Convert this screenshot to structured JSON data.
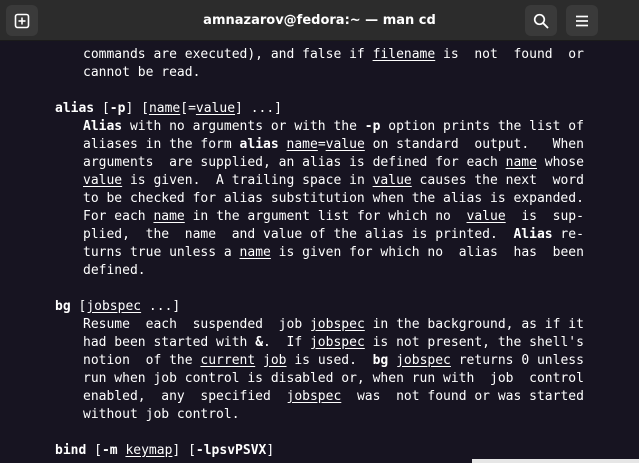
{
  "window": {
    "title": "amnazarov@fedora:~ — man cd",
    "icons": {
      "new_tab": "new-tab-icon",
      "search": "search-icon",
      "menu": "hamburger-menu-icon"
    }
  },
  "colors": {
    "headerbar": "#2c2c2c",
    "button": "#3a3a3a",
    "terminal_bg": "#171421",
    "text": "#ffffff"
  },
  "terminal": {
    "lines": [
      {
        "indent": 8,
        "segs": [
          {
            "t": "commands are executed), and false if "
          },
          {
            "t": "filename",
            "u": true
          },
          {
            "t": " is  not  found  or"
          }
        ]
      },
      {
        "indent": 8,
        "segs": [
          {
            "t": "cannot be read."
          }
        ]
      },
      {
        "indent": 0,
        "segs": []
      },
      {
        "indent": 4,
        "segs": [
          {
            "t": "alias",
            "b": true
          },
          {
            "t": " ["
          },
          {
            "t": "-p",
            "b": true
          },
          {
            "t": "] ["
          },
          {
            "t": "name",
            "u": true
          },
          {
            "t": "[="
          },
          {
            "t": "value",
            "u": true
          },
          {
            "t": "] ...]"
          }
        ]
      },
      {
        "indent": 8,
        "segs": [
          {
            "t": "Alias",
            "b": true
          },
          {
            "t": " with no arguments or with the "
          },
          {
            "t": "-p",
            "b": true
          },
          {
            "t": " option prints the list of"
          }
        ]
      },
      {
        "indent": 8,
        "segs": [
          {
            "t": "aliases in the form "
          },
          {
            "t": "alias",
            "b": true
          },
          {
            "t": " "
          },
          {
            "t": "name",
            "u": true
          },
          {
            "t": "="
          },
          {
            "t": "value",
            "u": true
          },
          {
            "t": " on standard  output.   When"
          }
        ]
      },
      {
        "indent": 8,
        "segs": [
          {
            "t": "arguments  are supplied, an alias is defined for each "
          },
          {
            "t": "name",
            "u": true
          },
          {
            "t": " whose"
          }
        ]
      },
      {
        "indent": 8,
        "segs": [
          {
            "t": "value",
            "u": true
          },
          {
            "t": " is given.  A trailing space in "
          },
          {
            "t": "value",
            "u": true
          },
          {
            "t": " causes the next  word"
          }
        ]
      },
      {
        "indent": 8,
        "segs": [
          {
            "t": "to be checked for alias substitution when the alias is expanded."
          }
        ]
      },
      {
        "indent": 8,
        "segs": [
          {
            "t": "For each "
          },
          {
            "t": "name",
            "u": true
          },
          {
            "t": " in the argument list for which no  "
          },
          {
            "t": "value",
            "u": true
          },
          {
            "t": "  is  sup-"
          }
        ]
      },
      {
        "indent": 8,
        "segs": [
          {
            "t": "plied,  the  name  and value of the alias is printed.  "
          },
          {
            "t": "Alias",
            "b": true
          },
          {
            "t": " re-"
          }
        ]
      },
      {
        "indent": 8,
        "segs": [
          {
            "t": "turns true unless a "
          },
          {
            "t": "name",
            "u": true
          },
          {
            "t": " is given for which no  alias  has  been"
          }
        ]
      },
      {
        "indent": 8,
        "segs": [
          {
            "t": "defined."
          }
        ]
      },
      {
        "indent": 0,
        "segs": []
      },
      {
        "indent": 4,
        "segs": [
          {
            "t": "bg",
            "b": true
          },
          {
            "t": " ["
          },
          {
            "t": "jobspec",
            "u": true
          },
          {
            "t": " ...]"
          }
        ]
      },
      {
        "indent": 8,
        "segs": [
          {
            "t": "Resume  each  suspended  job "
          },
          {
            "t": "jobspec",
            "u": true
          },
          {
            "t": " in the background, as if it"
          }
        ]
      },
      {
        "indent": 8,
        "segs": [
          {
            "t": "had been started with "
          },
          {
            "t": "&",
            "b": true
          },
          {
            "t": ".  If "
          },
          {
            "t": "jobspec",
            "u": true
          },
          {
            "t": " is not present, the shell's"
          }
        ]
      },
      {
        "indent": 8,
        "segs": [
          {
            "t": "notion  of the "
          },
          {
            "t": "current",
            "u": true
          },
          {
            "t": " "
          },
          {
            "t": "job",
            "u": true
          },
          {
            "t": " is used.  "
          },
          {
            "t": "bg",
            "b": true
          },
          {
            "t": " "
          },
          {
            "t": "jobspec",
            "u": true
          },
          {
            "t": " returns 0 unless"
          }
        ]
      },
      {
        "indent": 8,
        "segs": [
          {
            "t": "run when job control is disabled or, when run with  job  control"
          }
        ]
      },
      {
        "indent": 8,
        "segs": [
          {
            "t": "enabled,  any  specified  "
          },
          {
            "t": "jobspec",
            "u": true
          },
          {
            "t": "  was  not found or was started"
          }
        ]
      },
      {
        "indent": 8,
        "segs": [
          {
            "t": "without job control."
          }
        ]
      },
      {
        "indent": 0,
        "segs": []
      },
      {
        "indent": 4,
        "segs": [
          {
            "t": "bind",
            "b": true
          },
          {
            "t": " ["
          },
          {
            "t": "-m",
            "b": true
          },
          {
            "t": " "
          },
          {
            "t": "keymap",
            "u": true
          },
          {
            "t": "] ["
          },
          {
            "t": "-lpsvPSVX",
            "b": true
          },
          {
            "t": "]"
          }
        ]
      }
    ]
  }
}
